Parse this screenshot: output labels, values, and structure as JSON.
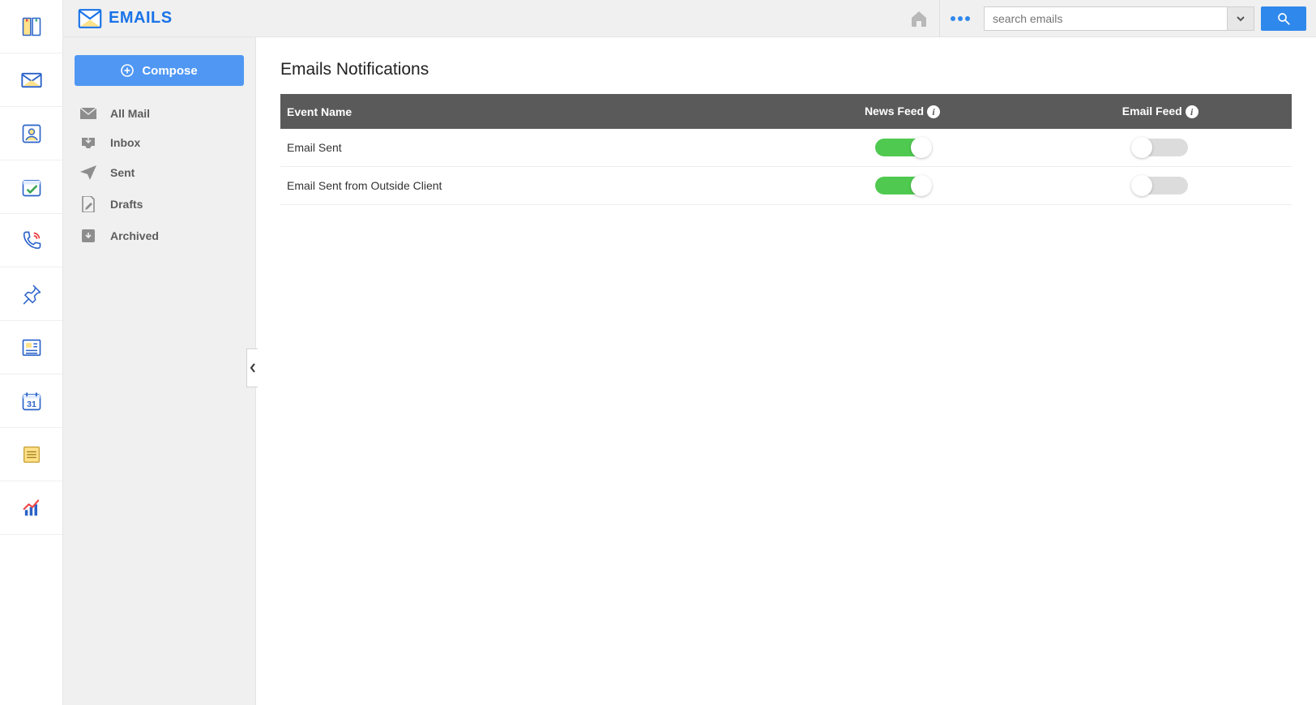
{
  "header": {
    "title": "EMAILS",
    "search_placeholder": "search emails"
  },
  "sidebar": {
    "compose_label": "Compose",
    "folders": [
      {
        "id": "all-mail",
        "label": "All Mail"
      },
      {
        "id": "inbox",
        "label": "Inbox"
      },
      {
        "id": "sent",
        "label": "Sent"
      },
      {
        "id": "drafts",
        "label": "Drafts"
      },
      {
        "id": "archived",
        "label": "Archived"
      }
    ]
  },
  "main": {
    "page_title": "Emails Notifications",
    "columns": {
      "event": "Event Name",
      "news_feed": "News Feed",
      "email_feed": "Email Feed"
    },
    "rows": [
      {
        "event": "Email Sent",
        "news_feed": true,
        "email_feed": false
      },
      {
        "event": "Email Sent from Outside Client",
        "news_feed": true,
        "email_feed": false
      }
    ]
  },
  "rail_items": [
    "book",
    "mail",
    "contact",
    "tasks",
    "phone",
    "pin",
    "news",
    "calendar",
    "notes",
    "reports"
  ],
  "colors": {
    "primary_blue": "#1a73e8",
    "button_blue": "#4f97f3",
    "toggle_green": "#4fc94f",
    "header_grey": "#5a5a5a"
  }
}
